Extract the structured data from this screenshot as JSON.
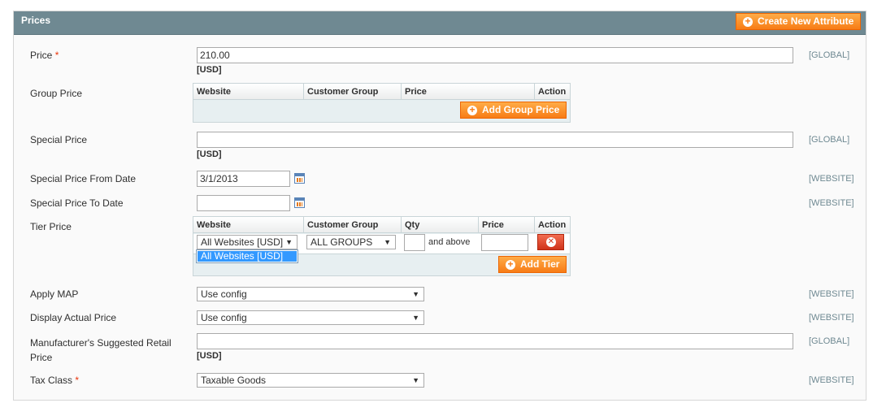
{
  "panel": {
    "title": "Prices",
    "create_attr_label": "Create New Attribute"
  },
  "fields": {
    "price": {
      "label": "Price",
      "required_mark": "*",
      "value": "210.00",
      "currency": "[USD]",
      "scope": "[GLOBAL]"
    },
    "group_price": {
      "label": "Group Price",
      "columns": [
        "Website",
        "Customer Group",
        "Price",
        "Action"
      ],
      "add_label": "Add Group Price"
    },
    "special_price": {
      "label": "Special Price",
      "value": "",
      "currency": "[USD]",
      "scope": "[GLOBAL]"
    },
    "special_from": {
      "label": "Special Price From Date",
      "value": "3/1/2013",
      "scope": "[WEBSITE]"
    },
    "special_to": {
      "label": "Special Price To Date",
      "value": "",
      "scope": "[WEBSITE]"
    },
    "tier_price": {
      "label": "Tier Price",
      "columns": [
        "Website",
        "Customer Group",
        "Qty",
        "Price",
        "Action"
      ],
      "row": {
        "website": "All Websites [USD]",
        "group": "ALL GROUPS",
        "qty": "",
        "and_above": "and above",
        "price": ""
      },
      "dropdown_option": "All Websites [USD]",
      "add_label": "Add Tier"
    },
    "apply_map": {
      "label": "Apply MAP",
      "value": "Use config",
      "scope": "[WEBSITE]"
    },
    "display_actual": {
      "label": "Display Actual Price",
      "value": "Use config",
      "scope": "[WEBSITE]"
    },
    "msrp": {
      "label_line1": "Manufacturer's Suggested Retail",
      "label_line2": "Price",
      "value": "",
      "currency": "[USD]",
      "scope": "[GLOBAL]"
    },
    "tax_class": {
      "label": "Tax Class",
      "required_mark": "*",
      "value": "Taxable Goods",
      "scope": "[WEBSITE]"
    }
  },
  "colors": {
    "header_bg": "#6f8992",
    "button_orange": "#f77c16",
    "required_red": "#eb340a",
    "scope_text": "#6f8992",
    "selection_blue": "#3399ff"
  },
  "icons": [
    "plus-circle-icon",
    "calendar-icon",
    "delete-x-icon",
    "chevron-down-icon"
  ]
}
